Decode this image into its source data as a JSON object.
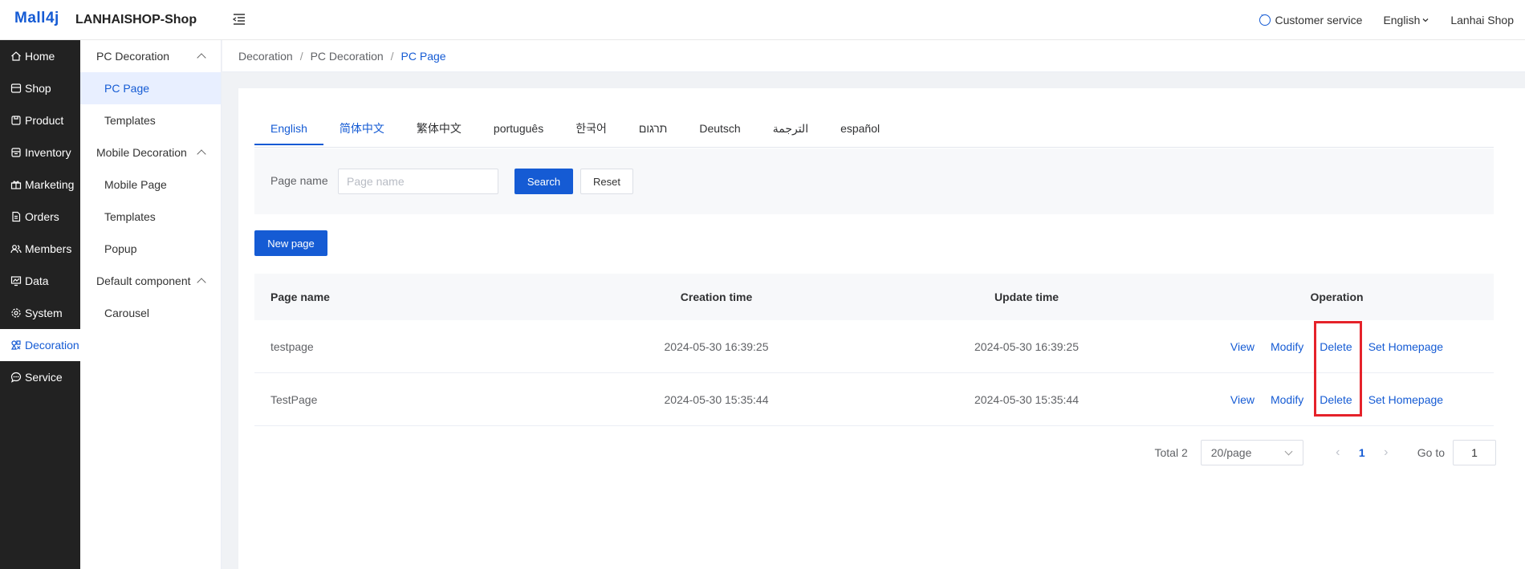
{
  "header": {
    "logo": "Mall4j",
    "shop_title": "LANHAISHOP-Shop",
    "customer_service": "Customer service",
    "language": "English",
    "user": "Lanhai Shop"
  },
  "sidebar": {
    "items": [
      {
        "label": "Home",
        "icon": "home-icon"
      },
      {
        "label": "Shop",
        "icon": "shop-icon"
      },
      {
        "label": "Product",
        "icon": "product-icon"
      },
      {
        "label": "Inventory",
        "icon": "inventory-icon"
      },
      {
        "label": "Marketing",
        "icon": "gift-icon"
      },
      {
        "label": "Orders",
        "icon": "orders-icon"
      },
      {
        "label": "Members",
        "icon": "members-icon"
      },
      {
        "label": "Data",
        "icon": "data-icon"
      },
      {
        "label": "System",
        "icon": "gear-icon"
      },
      {
        "label": "Decoration",
        "icon": "decoration-icon"
      },
      {
        "label": "Service",
        "icon": "chat-icon"
      }
    ]
  },
  "subnav": {
    "pc_group": "PC Decoration",
    "pc_page": "PC Page",
    "pc_templates": "Templates",
    "mobile_group": "Mobile Decoration",
    "mobile_page": "Mobile Page",
    "mobile_templates": "Templates",
    "popup": "Popup",
    "default_group": "Default component",
    "carousel": "Carousel"
  },
  "breadcrumb": {
    "l1": "Decoration",
    "l2": "PC Decoration",
    "l3": "PC Page",
    "sep": "/"
  },
  "tabs": [
    "English",
    "简体中文",
    "繁体中文",
    "português",
    "한국어",
    "תרגום",
    "Deutsch",
    "الترجمة",
    "español"
  ],
  "search": {
    "label": "Page name",
    "placeholder": "Page name",
    "search_btn": "Search",
    "reset_btn": "Reset"
  },
  "new_page_btn": "New page",
  "table": {
    "headers": {
      "name": "Page name",
      "created": "Creation time",
      "updated": "Update time",
      "operation": "Operation"
    },
    "rows": [
      {
        "name": "testpage",
        "created": "2024-05-30 16:39:25",
        "updated": "2024-05-30 16:39:25"
      },
      {
        "name": "TestPage",
        "created": "2024-05-30 15:35:44",
        "updated": "2024-05-30 15:35:44"
      }
    ],
    "ops": {
      "view": "View",
      "modify": "Modify",
      "delete": "Delete",
      "homepage": "Set Homepage"
    }
  },
  "pagination": {
    "total": "Total 2",
    "page_size": "20/page",
    "current": "1",
    "goto_label": "Go to",
    "goto_value": "1"
  },
  "colors": {
    "accent": "#155bd4",
    "sidebar_bg": "#222222",
    "highlight": "#e5222a"
  }
}
